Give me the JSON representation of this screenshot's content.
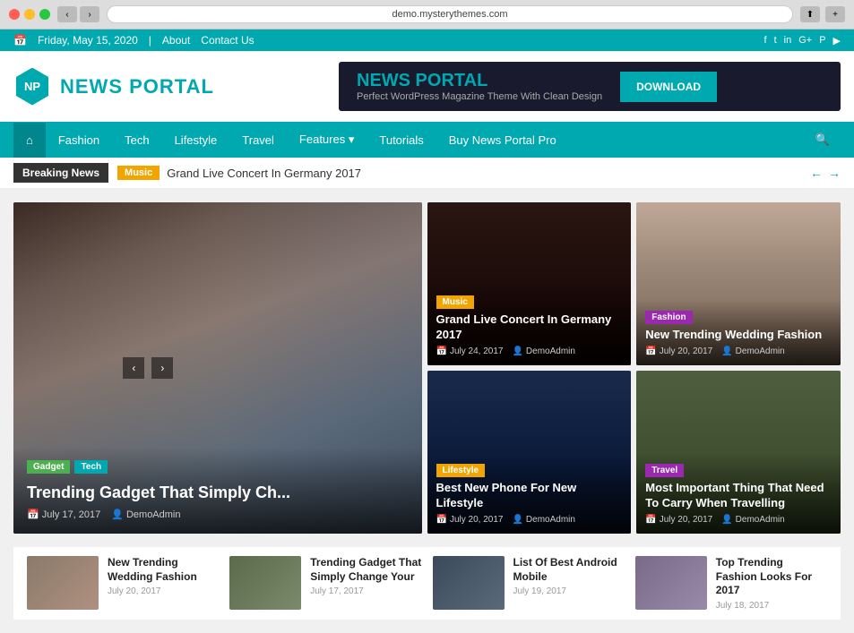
{
  "browser": {
    "url": "demo.mysterythemes.com",
    "nav_back": "‹",
    "nav_forward": "›"
  },
  "topbar": {
    "date": "Friday, May 15, 2020",
    "about": "About",
    "contact": "Contact Us",
    "socials": [
      "f",
      "t",
      "in",
      "G+",
      "P",
      "▶"
    ]
  },
  "header": {
    "logo_initials": "NP",
    "logo_news": "NEWS",
    "logo_portal": " PORTAL",
    "banner_title_news": "NEWS",
    "banner_title_portal": " PORTAL",
    "banner_subtitle": "Perfect WordPress Magazine Theme With Clean Design",
    "download_btn": "DOWNLOAD"
  },
  "nav": {
    "items": [
      {
        "label": "⌂",
        "id": "home"
      },
      {
        "label": "Fashion",
        "id": "fashion"
      },
      {
        "label": "Tech",
        "id": "tech"
      },
      {
        "label": "Lifestyle",
        "id": "lifestyle"
      },
      {
        "label": "Travel",
        "id": "travel"
      },
      {
        "label": "Features ▾",
        "id": "features"
      },
      {
        "label": "Tutorials",
        "id": "tutorials"
      },
      {
        "label": "Buy News Portal Pro",
        "id": "buy"
      }
    ]
  },
  "breaking_news": {
    "label": "Breaking News",
    "badge": "Music",
    "text": "Grand Live Concert In Germany 2017"
  },
  "featured": {
    "title": "Trending Gadget That Simply Ch...",
    "badges": [
      {
        "label": "Gadget",
        "class": "badge-gadget"
      },
      {
        "label": "Tech",
        "class": "badge-tech"
      }
    ],
    "date": "July 17, 2017",
    "author": "DemoAdmin"
  },
  "cards": [
    {
      "id": "music-card",
      "badge": "Music",
      "badge_class": "badge-music",
      "title": "Grand Live Concert In Germany 2017",
      "date": "July 24, 2017",
      "author": "DemoAdmin",
      "bg": "music"
    },
    {
      "id": "wedding-card",
      "badge": "Fashion",
      "badge_class": "badge-fashion",
      "title": "New Trending Wedding Fashion",
      "date": "July 20, 2017",
      "author": "DemoAdmin",
      "bg": "wedding"
    },
    {
      "id": "phone-card",
      "badge": "Lifestyle",
      "badge_class": "badge-lifestyle",
      "title": "Best New Phone For New Lifestyle",
      "date": "July 20, 2017",
      "author": "DemoAdmin",
      "bg": "phone"
    },
    {
      "id": "travel-card",
      "badge": "Travel",
      "badge_class": "badge-travel",
      "title": "Most Important Thing That Need To Carry When Travelling",
      "date": "July 20, 2017",
      "author": "DemoAdmin",
      "bg": "travel"
    }
  ],
  "bottom_list": [
    {
      "title": "New Trending Wedding Fashion",
      "date": "July 20, 2017",
      "bg": "wf"
    },
    {
      "title": "Trending Gadget That Simply Change Your",
      "date": "July 17, 2017",
      "bg": "tg"
    },
    {
      "title": "List Of Best Android Mobile",
      "date": "July 19, 2017",
      "bg": "android"
    },
    {
      "title": "Top Trending Fashion Looks For 2017",
      "date": "July 18, 2017",
      "bg": "fashion"
    }
  ]
}
